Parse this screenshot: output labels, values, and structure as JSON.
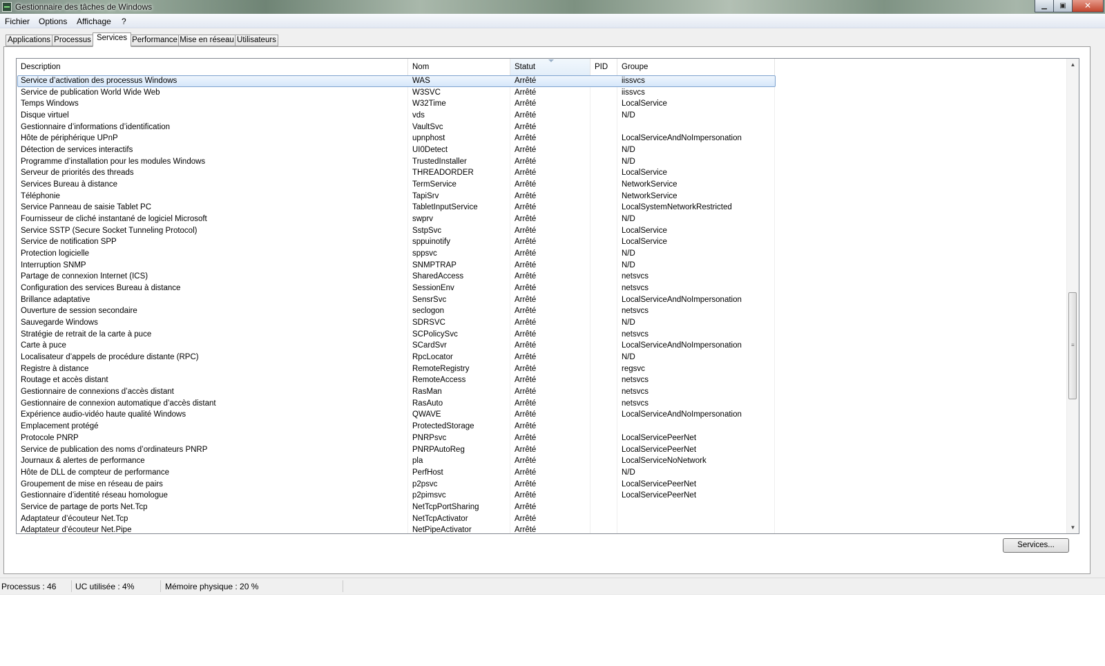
{
  "window": {
    "title": "Gestionnaire des tâches de Windows",
    "controls": {
      "minimize": "▁",
      "maximize": "▣",
      "close": "✕"
    }
  },
  "menu": [
    "Fichier",
    "Options",
    "Affichage",
    "?"
  ],
  "tabs": [
    "Applications",
    "Processus",
    "Services",
    "Performance",
    "Mise en réseau",
    "Utilisateurs"
  ],
  "active_tab": "Services",
  "table": {
    "columns": [
      "Description",
      "Nom",
      "Statut",
      "PID",
      "Groupe"
    ],
    "sorted_column": "Statut",
    "rows": [
      {
        "description": "Service d’activation des processus Windows",
        "name": "WAS",
        "status": "Arrêté",
        "pid": "",
        "group": "iissvcs"
      },
      {
        "description": "Service de publication World Wide Web",
        "name": "W3SVC",
        "status": "Arrêté",
        "pid": "",
        "group": "iissvcs"
      },
      {
        "description": "Temps Windows",
        "name": "W32Time",
        "status": "Arrêté",
        "pid": "",
        "group": "LocalService"
      },
      {
        "description": "Disque virtuel",
        "name": "vds",
        "status": "Arrêté",
        "pid": "",
        "group": "N/D"
      },
      {
        "description": "Gestionnaire d’informations d’identification",
        "name": "VaultSvc",
        "status": "Arrêté",
        "pid": "",
        "group": ""
      },
      {
        "description": "Hôte de périphérique UPnP",
        "name": "upnphost",
        "status": "Arrêté",
        "pid": "",
        "group": "LocalServiceAndNoImpersonation"
      },
      {
        "description": "Détection de services interactifs",
        "name": "UI0Detect",
        "status": "Arrêté",
        "pid": "",
        "group": "N/D"
      },
      {
        "description": "Programme d’installation pour les modules Windows",
        "name": "TrustedInstaller",
        "status": "Arrêté",
        "pid": "",
        "group": "N/D"
      },
      {
        "description": "Serveur de priorités des threads",
        "name": "THREADORDER",
        "status": "Arrêté",
        "pid": "",
        "group": "LocalService"
      },
      {
        "description": "Services Bureau à distance",
        "name": "TermService",
        "status": "Arrêté",
        "pid": "",
        "group": "NetworkService"
      },
      {
        "description": "Téléphonie",
        "name": "TapiSrv",
        "status": "Arrêté",
        "pid": "",
        "group": "NetworkService"
      },
      {
        "description": "Service Panneau de saisie Tablet PC",
        "name": "TabletInputService",
        "status": "Arrêté",
        "pid": "",
        "group": "LocalSystemNetworkRestricted"
      },
      {
        "description": "Fournisseur de cliché instantané de logiciel Microsoft",
        "name": "swprv",
        "status": "Arrêté",
        "pid": "",
        "group": "N/D"
      },
      {
        "description": "Service SSTP (Secure Socket Tunneling Protocol)",
        "name": "SstpSvc",
        "status": "Arrêté",
        "pid": "",
        "group": "LocalService"
      },
      {
        "description": "Service de notification SPP",
        "name": "sppuinotify",
        "status": "Arrêté",
        "pid": "",
        "group": "LocalService"
      },
      {
        "description": "Protection logicielle",
        "name": "sppsvc",
        "status": "Arrêté",
        "pid": "",
        "group": "N/D"
      },
      {
        "description": "Interruption SNMP",
        "name": "SNMPTRAP",
        "status": "Arrêté",
        "pid": "",
        "group": "N/D"
      },
      {
        "description": "Partage de connexion Internet (ICS)",
        "name": "SharedAccess",
        "status": "Arrêté",
        "pid": "",
        "group": "netsvcs"
      },
      {
        "description": "Configuration des services Bureau à distance",
        "name": "SessionEnv",
        "status": "Arrêté",
        "pid": "",
        "group": "netsvcs"
      },
      {
        "description": "Brillance adaptative",
        "name": "SensrSvc",
        "status": "Arrêté",
        "pid": "",
        "group": "LocalServiceAndNoImpersonation"
      },
      {
        "description": "Ouverture de session secondaire",
        "name": "seclogon",
        "status": "Arrêté",
        "pid": "",
        "group": "netsvcs"
      },
      {
        "description": "Sauvegarde Windows",
        "name": "SDRSVC",
        "status": "Arrêté",
        "pid": "",
        "group": "N/D"
      },
      {
        "description": "Stratégie de retrait de la carte à puce",
        "name": "SCPolicySvc",
        "status": "Arrêté",
        "pid": "",
        "group": "netsvcs"
      },
      {
        "description": "Carte à puce",
        "name": "SCardSvr",
        "status": "Arrêté",
        "pid": "",
        "group": "LocalServiceAndNoImpersonation"
      },
      {
        "description": "Localisateur d’appels de procédure distante (RPC)",
        "name": "RpcLocator",
        "status": "Arrêté",
        "pid": "",
        "group": "N/D"
      },
      {
        "description": "Registre à distance",
        "name": "RemoteRegistry",
        "status": "Arrêté",
        "pid": "",
        "group": "regsvc"
      },
      {
        "description": "Routage et accès distant",
        "name": "RemoteAccess",
        "status": "Arrêté",
        "pid": "",
        "group": "netsvcs"
      },
      {
        "description": "Gestionnaire de connexions d’accès distant",
        "name": "RasMan",
        "status": "Arrêté",
        "pid": "",
        "group": "netsvcs"
      },
      {
        "description": "Gestionnaire de connexion automatique d’accès distant",
        "name": "RasAuto",
        "status": "Arrêté",
        "pid": "",
        "group": "netsvcs"
      },
      {
        "description": "Expérience audio-vidéo haute qualité Windows",
        "name": "QWAVE",
        "status": "Arrêté",
        "pid": "",
        "group": "LocalServiceAndNoImpersonation"
      },
      {
        "description": "Emplacement protégé",
        "name": "ProtectedStorage",
        "status": "Arrêté",
        "pid": "",
        "group": ""
      },
      {
        "description": "Protocole PNRP",
        "name": "PNRPsvc",
        "status": "Arrêté",
        "pid": "",
        "group": "LocalServicePeerNet"
      },
      {
        "description": "Service de publication des noms d’ordinateurs PNRP",
        "name": "PNRPAutoReg",
        "status": "Arrêté",
        "pid": "",
        "group": "LocalServicePeerNet"
      },
      {
        "description": "Journaux & alertes de performance",
        "name": "pla",
        "status": "Arrêté",
        "pid": "",
        "group": "LocalServiceNoNetwork"
      },
      {
        "description": "Hôte de DLL de compteur de performance",
        "name": "PerfHost",
        "status": "Arrêté",
        "pid": "",
        "group": "N/D"
      },
      {
        "description": "Groupement de mise en réseau de pairs",
        "name": "p2psvc",
        "status": "Arrêté",
        "pid": "",
        "group": "LocalServicePeerNet"
      },
      {
        "description": "Gestionnaire d’identité réseau homologue",
        "name": "p2pimsvc",
        "status": "Arrêté",
        "pid": "",
        "group": "LocalServicePeerNet"
      },
      {
        "description": "Service de partage de ports Net.Tcp",
        "name": "NetTcpPortSharing",
        "status": "Arrêté",
        "pid": "",
        "group": ""
      },
      {
        "description": "Adaptateur d’écouteur Net.Tcp",
        "name": "NetTcpActivator",
        "status": "Arrêté",
        "pid": "",
        "group": ""
      },
      {
        "description": "Adaptateur d’écouteur Net.Pipe",
        "name": "NetPipeActivator",
        "status": "Arrêté",
        "pid": "",
        "group": ""
      }
    ]
  },
  "services_button": "Services...",
  "scrollbar": {
    "up_icon": "▲",
    "down_icon": "▼",
    "grip": "≡"
  },
  "status": {
    "processes": "Processus : 46",
    "cpu": "UC utilisée : 4%",
    "memory": "Mémoire physique : 20 %"
  }
}
